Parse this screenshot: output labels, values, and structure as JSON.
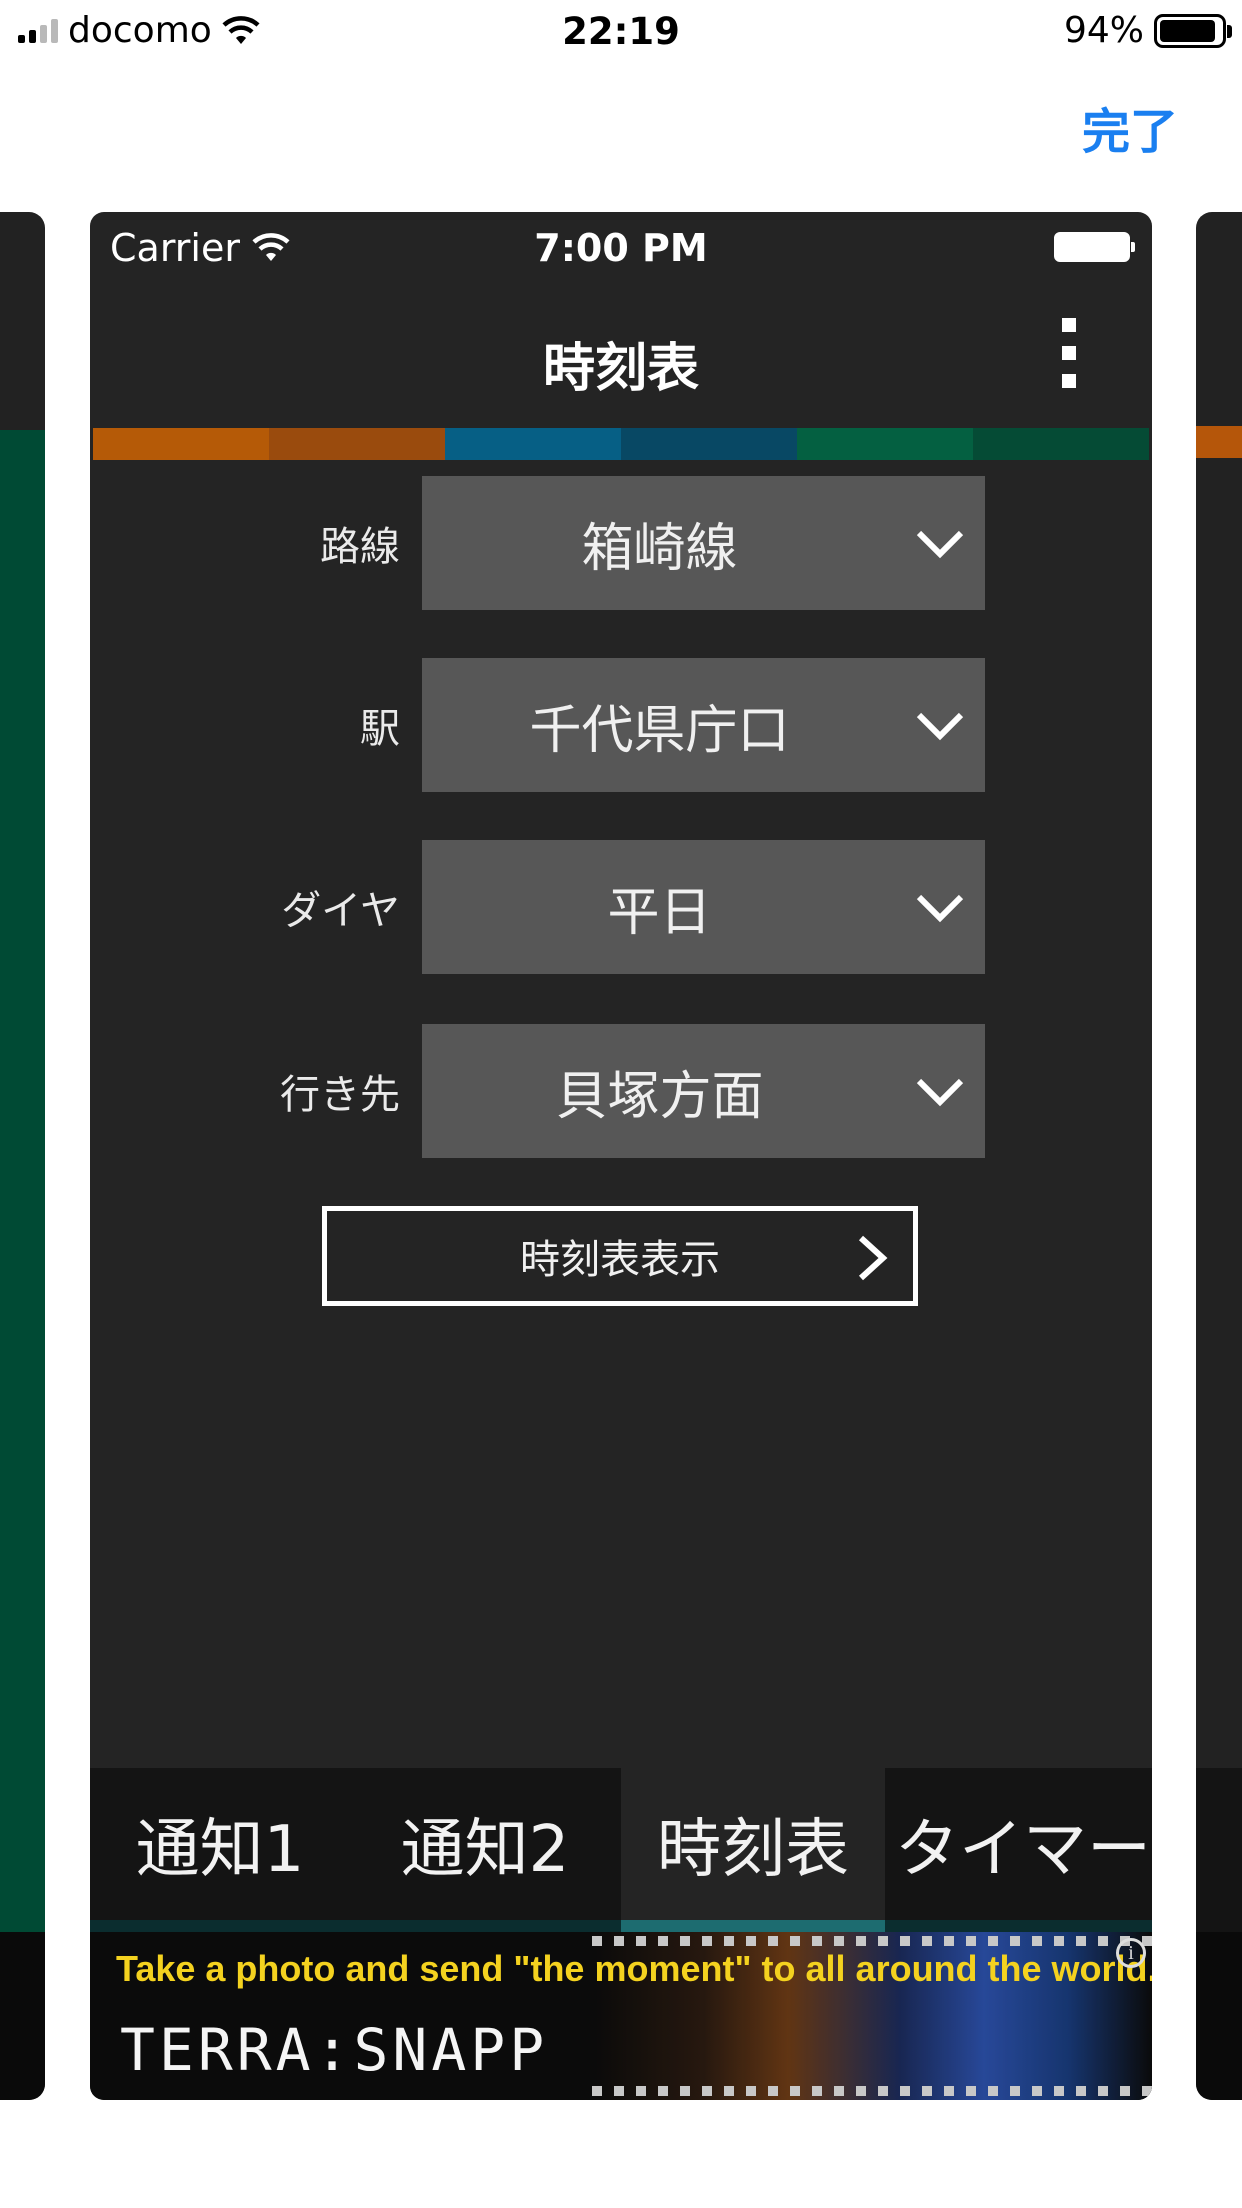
{
  "ios_status": {
    "carrier": "docomo",
    "time": "22:19",
    "battery": "94%"
  },
  "nav": {
    "done_label": "完了"
  },
  "app_status": {
    "carrier": "Carrier",
    "time": "7:00 PM"
  },
  "app": {
    "title": "時刻表"
  },
  "colors": {
    "strip": [
      "#b55a07",
      "#9a4b0d",
      "#065f85",
      "#084864",
      "#046041",
      "#054b35"
    ],
    "select_bg": "#575757",
    "active_tab_line": "#1d6c70",
    "done_link": "#1a7ff0",
    "ad_text": "#f4d21f"
  },
  "form": {
    "rows": [
      {
        "label": "路線",
        "value": "箱崎線"
      },
      {
        "label": "駅",
        "value": "千代県庁口"
      },
      {
        "label": "ダイヤ",
        "value": "平日"
      },
      {
        "label": "行き先",
        "value": "貝塚方面"
      }
    ],
    "submit_label": "時刻表表示"
  },
  "tabs": [
    {
      "label": "通知1",
      "active": false
    },
    {
      "label": "通知2",
      "active": false
    },
    {
      "label": "時刻表",
      "active": true
    },
    {
      "label": "タイマー",
      "active": false
    }
  ],
  "ad": {
    "tagline": "Take a photo and send  \"the moment\" to all around the world.",
    "logo": "TERRA:SNAPP",
    "info_icon": "info-icon"
  }
}
